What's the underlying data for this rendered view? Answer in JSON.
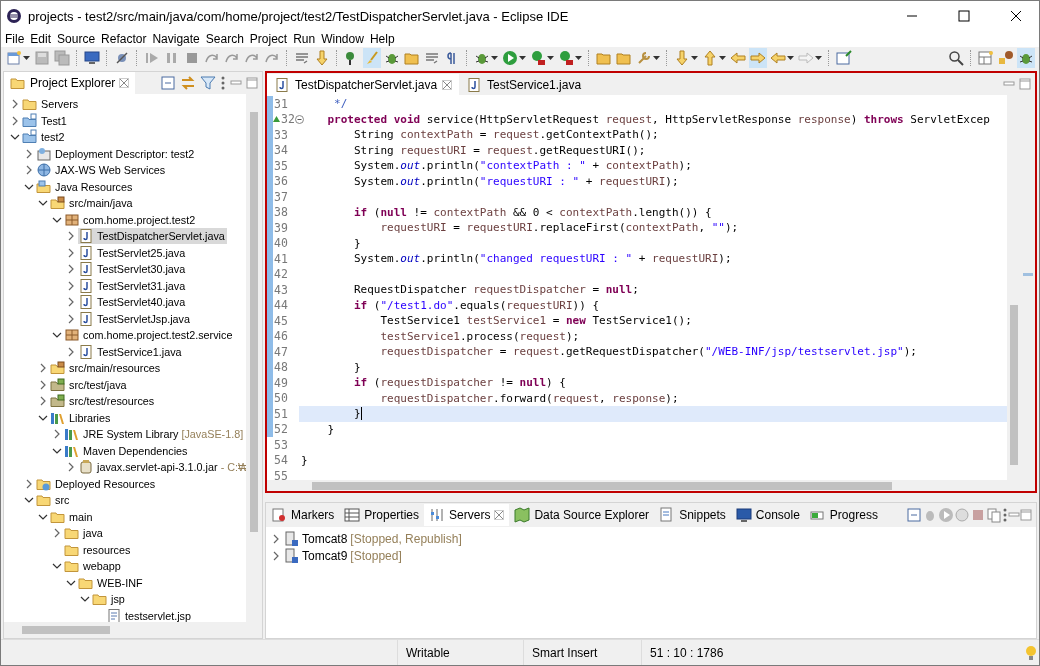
{
  "window": {
    "title": "projects - test2/src/main/java/com/home/project/test2/TestDispatcherServlet.java - Eclipse IDE"
  },
  "menu": [
    "File",
    "Edit",
    "Source",
    "Refactor",
    "Navigate",
    "Search",
    "Project",
    "Run",
    "Window",
    "Help"
  ],
  "project_explorer": {
    "title": "Project Explorer",
    "tree": [
      {
        "label": "Servers",
        "kind": "folder",
        "expanded": false,
        "selected": false
      },
      {
        "label": "Test1",
        "kind": "project",
        "expanded": false,
        "selected": false
      },
      {
        "label": "test2",
        "kind": "project",
        "expanded": true,
        "selected": false,
        "children": [
          {
            "label": "Deployment Descriptor: test2",
            "kind": "descriptor",
            "expanded": false,
            "selected": false
          },
          {
            "label": "JAX-WS Web Services",
            "kind": "webservices",
            "expanded": false,
            "selected": false
          },
          {
            "label": "Java Resources",
            "kind": "javares",
            "expanded": true,
            "selected": false,
            "children": [
              {
                "label": "src/main/java",
                "kind": "srcfolder",
                "expanded": true,
                "selected": false,
                "children": [
                  {
                    "label": "com.home.project.test2",
                    "kind": "package",
                    "expanded": true,
                    "selected": false,
                    "children": [
                      {
                        "label": "TestDispatcherServlet.java",
                        "kind": "java",
                        "expanded": false,
                        "selected": true
                      },
                      {
                        "label": "TestServlet25.java",
                        "kind": "java",
                        "expanded": false,
                        "selected": false
                      },
                      {
                        "label": "TestServlet30.java",
                        "kind": "java",
                        "expanded": false,
                        "selected": false
                      },
                      {
                        "label": "TestServlet31.java",
                        "kind": "java",
                        "expanded": false,
                        "selected": false
                      },
                      {
                        "label": "TestServlet40.java",
                        "kind": "java",
                        "expanded": false,
                        "selected": false
                      },
                      {
                        "label": "TestServletJsp.java",
                        "kind": "java",
                        "expanded": false,
                        "selected": false
                      }
                    ]
                  },
                  {
                    "label": "com.home.project.test2.service",
                    "kind": "package",
                    "expanded": true,
                    "selected": false,
                    "children": [
                      {
                        "label": "TestService1.java",
                        "kind": "java",
                        "expanded": false,
                        "selected": false
                      }
                    ]
                  }
                ]
              },
              {
                "label": "src/main/resources",
                "kind": "srcfolder",
                "expanded": false,
                "selected": false
              },
              {
                "label": "src/test/java",
                "kind": "testfolder",
                "expanded": false,
                "selected": false
              },
              {
                "label": "src/test/resources",
                "kind": "testfolder",
                "expanded": false,
                "selected": false
              },
              {
                "label": "Libraries",
                "kind": "library",
                "expanded": true,
                "selected": false,
                "children": [
                  {
                    "label": "JRE System Library",
                    "note": "[JavaSE-1.8]",
                    "kind": "library",
                    "expanded": false,
                    "selected": false
                  },
                  {
                    "label": "Maven Dependencies",
                    "kind": "library",
                    "expanded": true,
                    "selected": false,
                    "children": [
                      {
                        "label": "javax.servlet-api-3.1.0.jar",
                        "note": "- C:₩",
                        "kind": "jar",
                        "expanded": false,
                        "selected": false
                      }
                    ]
                  }
                ]
              }
            ]
          },
          {
            "label": "Deployed Resources",
            "kind": "deployed",
            "expanded": false,
            "selected": false
          },
          {
            "label": "src",
            "kind": "folder",
            "expanded": true,
            "selected": false,
            "children": [
              {
                "label": "main",
                "kind": "folder",
                "expanded": true,
                "selected": false,
                "children": [
                  {
                    "label": "java",
                    "kind": "folder",
                    "expanded": false,
                    "selected": false
                  },
                  {
                    "label": "resources",
                    "kind": "folder",
                    "selected": false
                  },
                  {
                    "label": "webapp",
                    "kind": "folder",
                    "expanded": true,
                    "selected": false,
                    "children": [
                      {
                        "label": "WEB-INF",
                        "kind": "folder",
                        "expanded": true,
                        "selected": false,
                        "children": [
                          {
                            "label": "jsp",
                            "kind": "folder",
                            "expanded": true,
                            "selected": false,
                            "children": [
                              {
                                "label": "testservlet.jsp",
                                "kind": "jsp",
                                "selected": false
                              }
                            ]
                          }
                        ]
                      }
                    ]
                  }
                ]
              }
            ]
          }
        ]
      }
    ]
  },
  "editor": {
    "tabs": [
      {
        "label": "TestDispatcherServlet.java",
        "selected": true
      },
      {
        "label": "TestService1.java",
        "selected": false
      }
    ],
    "lines": [
      {
        "no": "31",
        "changed": true,
        "current": false,
        "tokens": [
          {
            "kind": "comment",
            "text": "     */"
          }
        ]
      },
      {
        "no": "32",
        "changed": true,
        "current": false,
        "kind": "override",
        "tokens": [
          {
            "kind": "keyword",
            "text": "    protected void"
          },
          {
            "kind": "plain",
            "text": " service(HttpServletRequest "
          },
          {
            "kind": "variable",
            "text": "request"
          },
          {
            "kind": "plain",
            "text": ", HttpServletResponse "
          },
          {
            "kind": "variable",
            "text": "response"
          },
          {
            "kind": "plain",
            "text": ") "
          },
          {
            "kind": "keyword",
            "text": "throws"
          },
          {
            "kind": "plain",
            "text": " ServletExcep"
          }
        ]
      },
      {
        "no": "33",
        "changed": true,
        "current": false,
        "tokens": [
          {
            "kind": "plain",
            "text": "        String "
          },
          {
            "kind": "variable",
            "text": "contextPath"
          },
          {
            "kind": "plain",
            "text": " = "
          },
          {
            "kind": "variable",
            "text": "request"
          },
          {
            "kind": "plain",
            "text": ".getContextPath();"
          }
        ]
      },
      {
        "no": "34",
        "changed": true,
        "current": false,
        "tokens": [
          {
            "kind": "plain",
            "text": "        String "
          },
          {
            "kind": "variable",
            "text": "requestURI"
          },
          {
            "kind": "plain",
            "text": " = "
          },
          {
            "kind": "variable",
            "text": "request"
          },
          {
            "kind": "plain",
            "text": ".getRequestURI();"
          }
        ]
      },
      {
        "no": "35",
        "changed": true,
        "current": false,
        "tokens": [
          {
            "kind": "plain",
            "text": "        System."
          },
          {
            "kind": "field",
            "text": "out"
          },
          {
            "kind": "plain",
            "text": ".println("
          },
          {
            "kind": "string",
            "text": "\"contextPath : \""
          },
          {
            "kind": "plain",
            "text": " + "
          },
          {
            "kind": "variable",
            "text": "contextPath"
          },
          {
            "kind": "plain",
            "text": ");"
          }
        ]
      },
      {
        "no": "36",
        "changed": true,
        "current": false,
        "tokens": [
          {
            "kind": "plain",
            "text": "        System."
          },
          {
            "kind": "field",
            "text": "out"
          },
          {
            "kind": "plain",
            "text": ".println("
          },
          {
            "kind": "string",
            "text": "\"requestURI : \""
          },
          {
            "kind": "plain",
            "text": " + "
          },
          {
            "kind": "variable",
            "text": "requestURI"
          },
          {
            "kind": "plain",
            "text": ");"
          }
        ]
      },
      {
        "no": "37",
        "changed": true,
        "current": false
      },
      {
        "no": "38",
        "changed": true,
        "current": false,
        "tokens": [
          {
            "kind": "keyword",
            "text": "        if"
          },
          {
            "kind": "plain",
            "text": " ("
          },
          {
            "kind": "keyword",
            "text": "null"
          },
          {
            "kind": "plain",
            "text": " != "
          },
          {
            "kind": "variable",
            "text": "contextPath"
          },
          {
            "kind": "plain",
            "text": " && 0 < "
          },
          {
            "kind": "variable",
            "text": "contextPath"
          },
          {
            "kind": "plain",
            "text": ".length()) {"
          }
        ]
      },
      {
        "no": "39",
        "changed": true,
        "current": false,
        "tokens": [
          {
            "kind": "variable",
            "text": "            requestURI"
          },
          {
            "kind": "plain",
            "text": " = "
          },
          {
            "kind": "variable",
            "text": "requestURI"
          },
          {
            "kind": "plain",
            "text": ".replaceFirst("
          },
          {
            "kind": "variable",
            "text": "contextPath"
          },
          {
            "kind": "plain",
            "text": ", "
          },
          {
            "kind": "string",
            "text": "\"\""
          },
          {
            "kind": "plain",
            "text": ");"
          }
        ]
      },
      {
        "no": "40",
        "changed": true,
        "current": false,
        "tokens": [
          {
            "kind": "plain",
            "text": "        }"
          }
        ]
      },
      {
        "no": "41",
        "changed": true,
        "current": false,
        "tokens": [
          {
            "kind": "plain",
            "text": "        System."
          },
          {
            "kind": "field",
            "text": "out"
          },
          {
            "kind": "plain",
            "text": ".println("
          },
          {
            "kind": "string",
            "text": "\"changed requestURI : \""
          },
          {
            "kind": "plain",
            "text": " + "
          },
          {
            "kind": "variable",
            "text": "requestURI"
          },
          {
            "kind": "plain",
            "text": ");"
          }
        ]
      },
      {
        "no": "42",
        "changed": true,
        "current": false
      },
      {
        "no": "43",
        "changed": true,
        "current": false,
        "tokens": [
          {
            "kind": "plain",
            "text": "        RequestDispatcher "
          },
          {
            "kind": "variable",
            "text": "requestDispatcher"
          },
          {
            "kind": "plain",
            "text": " = "
          },
          {
            "kind": "keyword",
            "text": "null"
          },
          {
            "kind": "plain",
            "text": ";"
          }
        ]
      },
      {
        "no": "44",
        "changed": true,
        "current": false,
        "tokens": [
          {
            "kind": "keyword",
            "text": "        if"
          },
          {
            "kind": "plain",
            "text": " ("
          },
          {
            "kind": "string",
            "text": "\"/test1.do\""
          },
          {
            "kind": "plain",
            "text": ".equals("
          },
          {
            "kind": "variable",
            "text": "requestURI"
          },
          {
            "kind": "plain",
            "text": ")) {"
          }
        ]
      },
      {
        "no": "45",
        "changed": true,
        "current": false,
        "tokens": [
          {
            "kind": "plain",
            "text": "            TestService1 "
          },
          {
            "kind": "variable",
            "text": "testService1"
          },
          {
            "kind": "plain",
            "text": " = "
          },
          {
            "kind": "keyword",
            "text": "new"
          },
          {
            "kind": "plain",
            "text": " TestService1();"
          }
        ]
      },
      {
        "no": "46",
        "changed": true,
        "current": false,
        "tokens": [
          {
            "kind": "variable",
            "text": "            testService1"
          },
          {
            "kind": "plain",
            "text": ".process("
          },
          {
            "kind": "variable",
            "text": "request"
          },
          {
            "kind": "plain",
            "text": ");"
          }
        ]
      },
      {
        "no": "47",
        "changed": true,
        "current": false,
        "tokens": [
          {
            "kind": "variable",
            "text": "            requestDispatcher"
          },
          {
            "kind": "plain",
            "text": " = "
          },
          {
            "kind": "variable",
            "text": "request"
          },
          {
            "kind": "plain",
            "text": ".getRequestDispatcher("
          },
          {
            "kind": "string",
            "text": "\"/WEB-INF/jsp/testservlet.jsp\""
          },
          {
            "kind": "plain",
            "text": ");"
          }
        ]
      },
      {
        "no": "48",
        "changed": true,
        "current": false,
        "tokens": [
          {
            "kind": "plain",
            "text": "        }"
          }
        ]
      },
      {
        "no": "49",
        "changed": true,
        "current": false,
        "tokens": [
          {
            "kind": "keyword",
            "text": "        if"
          },
          {
            "kind": "plain",
            "text": " ("
          },
          {
            "kind": "variable",
            "text": "requestDispatcher"
          },
          {
            "kind": "plain",
            "text": " != "
          },
          {
            "kind": "keyword",
            "text": "null"
          },
          {
            "kind": "plain",
            "text": ") {"
          }
        ]
      },
      {
        "no": "50",
        "changed": true,
        "current": false,
        "tokens": [
          {
            "kind": "variable",
            "text": "            requestDispatcher"
          },
          {
            "kind": "plain",
            "text": ".forward("
          },
          {
            "kind": "variable",
            "text": "request"
          },
          {
            "kind": "plain",
            "text": ", "
          },
          {
            "kind": "variable",
            "text": "response"
          },
          {
            "kind": "plain",
            "text": ");"
          }
        ]
      },
      {
        "no": "51",
        "changed": true,
        "current": true,
        "tokens": [
          {
            "kind": "plain",
            "text": "        }"
          }
        ]
      },
      {
        "no": "52",
        "changed": true,
        "current": false,
        "tokens": [
          {
            "kind": "plain",
            "text": "    }"
          }
        ]
      },
      {
        "no": "53",
        "changed": false,
        "current": false
      },
      {
        "no": "54",
        "changed": false,
        "current": false,
        "tokens": [
          {
            "kind": "plain",
            "text": "}"
          }
        ]
      },
      {
        "no": "55",
        "changed": false,
        "current": false
      }
    ]
  },
  "bottom_panel": {
    "tabs": [
      {
        "label": "Markers",
        "kind": "markers",
        "selected": false
      },
      {
        "label": "Properties",
        "kind": "properties",
        "selected": false
      },
      {
        "label": "Servers",
        "kind": "servers",
        "selected": true
      },
      {
        "label": "Data Source Explorer",
        "kind": "datasource",
        "selected": false
      },
      {
        "label": "Snippets",
        "kind": "snippets",
        "selected": false
      },
      {
        "label": "Console",
        "kind": "console",
        "selected": false
      },
      {
        "label": "Progress",
        "kind": "progress",
        "selected": false
      }
    ],
    "servers": [
      {
        "name": "Tomcat8",
        "status": "[Stopped, Republish]"
      },
      {
        "name": "Tomcat9",
        "status": "[Stopped]"
      }
    ]
  },
  "status_bar": {
    "mode": "Writable",
    "insert_mode": "Smart Insert",
    "position": "51 : 10 : 1786"
  }
}
